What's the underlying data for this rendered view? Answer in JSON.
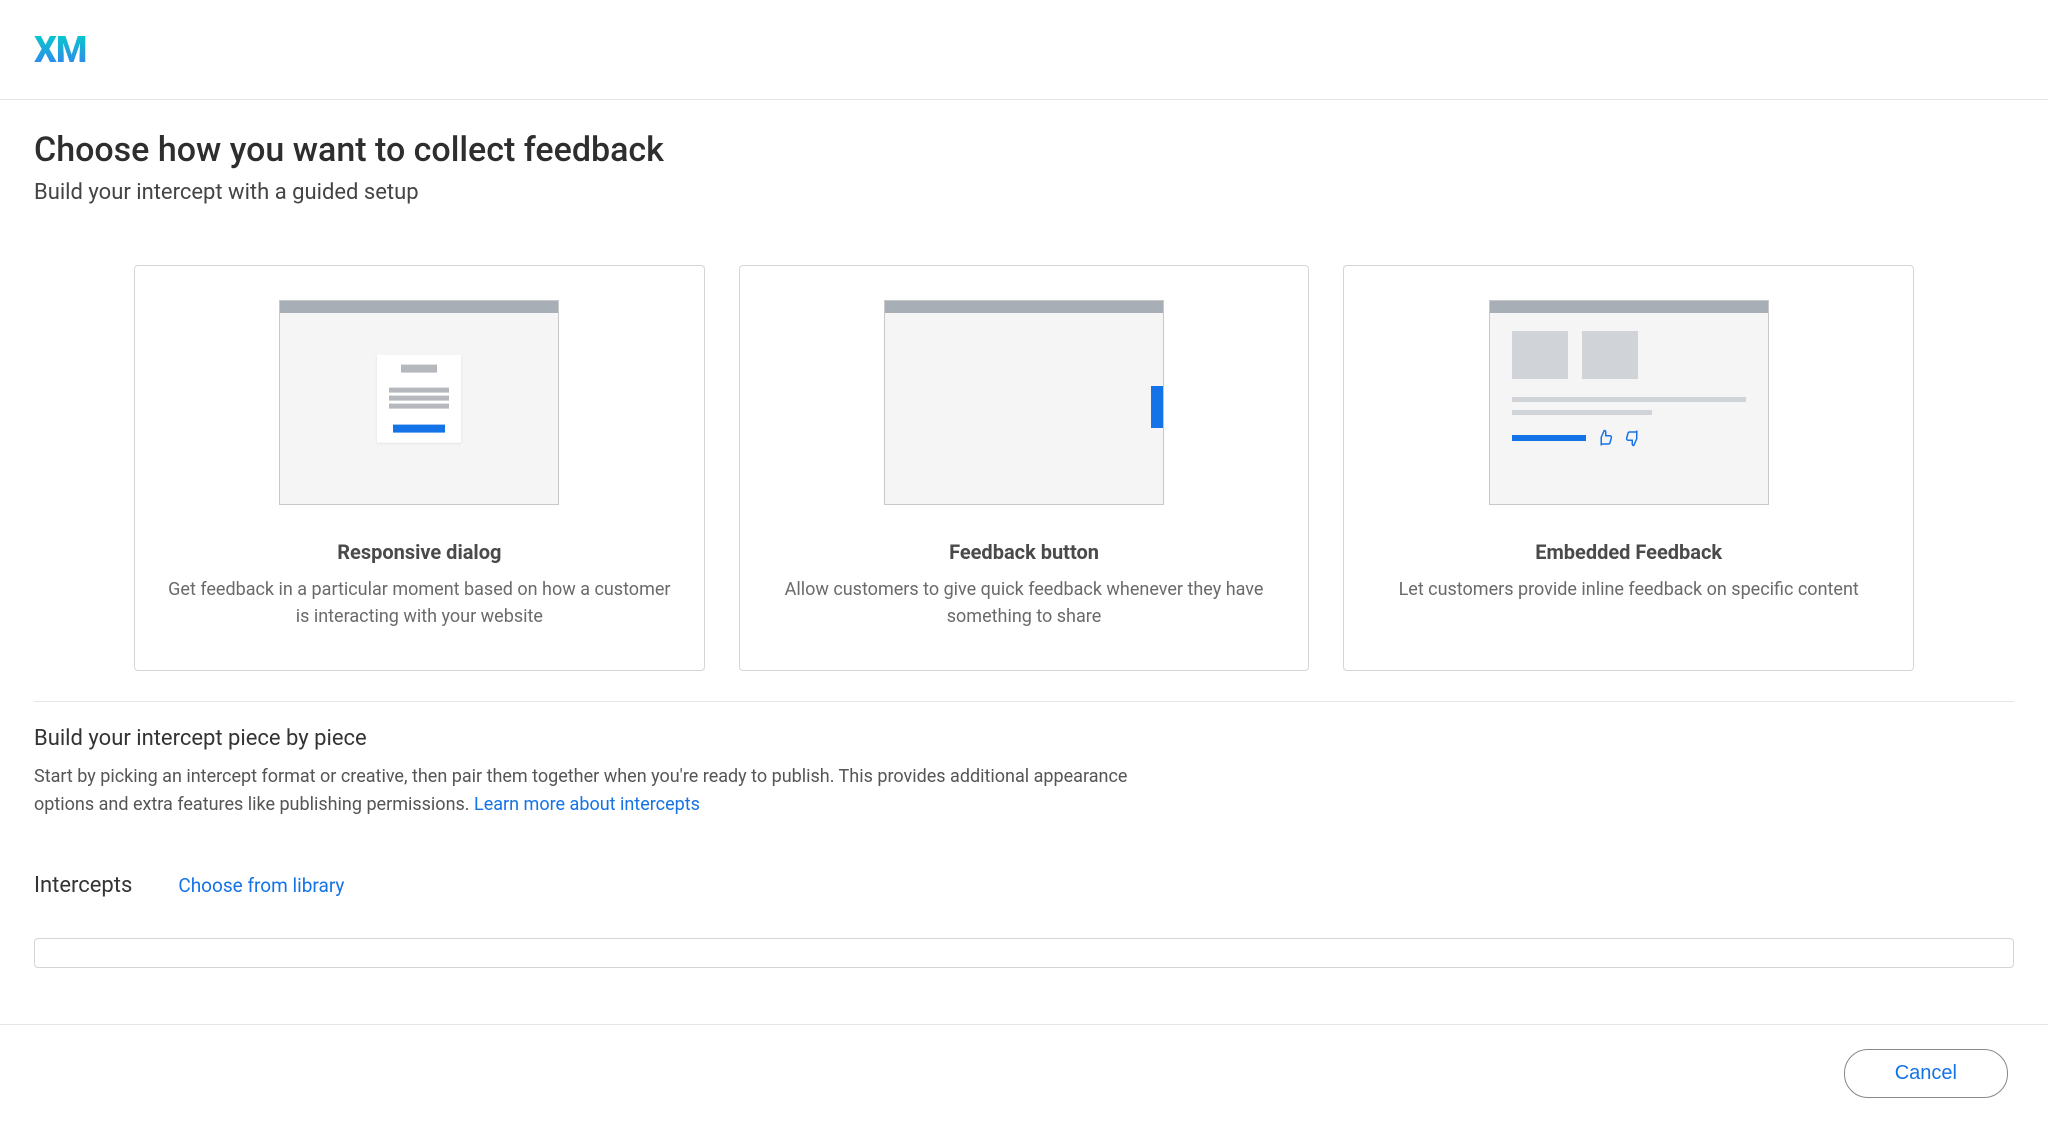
{
  "header": {
    "logo": "XM"
  },
  "page": {
    "title": "Choose how you want to collect feedback",
    "subtitle": "Build your intercept with a guided setup"
  },
  "cards": [
    {
      "title": "Responsive dialog",
      "desc": "Get feedback in a particular moment based on how a customer is interacting with your website"
    },
    {
      "title": "Feedback button",
      "desc": "Allow customers to give quick feedback whenever they have something to share"
    },
    {
      "title": "Embedded Feedback",
      "desc": "Let customers provide inline feedback on specific content"
    }
  ],
  "sectionB": {
    "heading": "Build your intercept piece by piece",
    "desc": "Start by picking an intercept format or creative, then pair them together when you're ready to publish. This provides additional appearance options and extra features like publishing permissions. ",
    "learn_more": "Learn more about intercepts"
  },
  "intercepts": {
    "label": "Intercepts",
    "choose": "Choose from library"
  },
  "footer": {
    "cancel": "Cancel"
  }
}
